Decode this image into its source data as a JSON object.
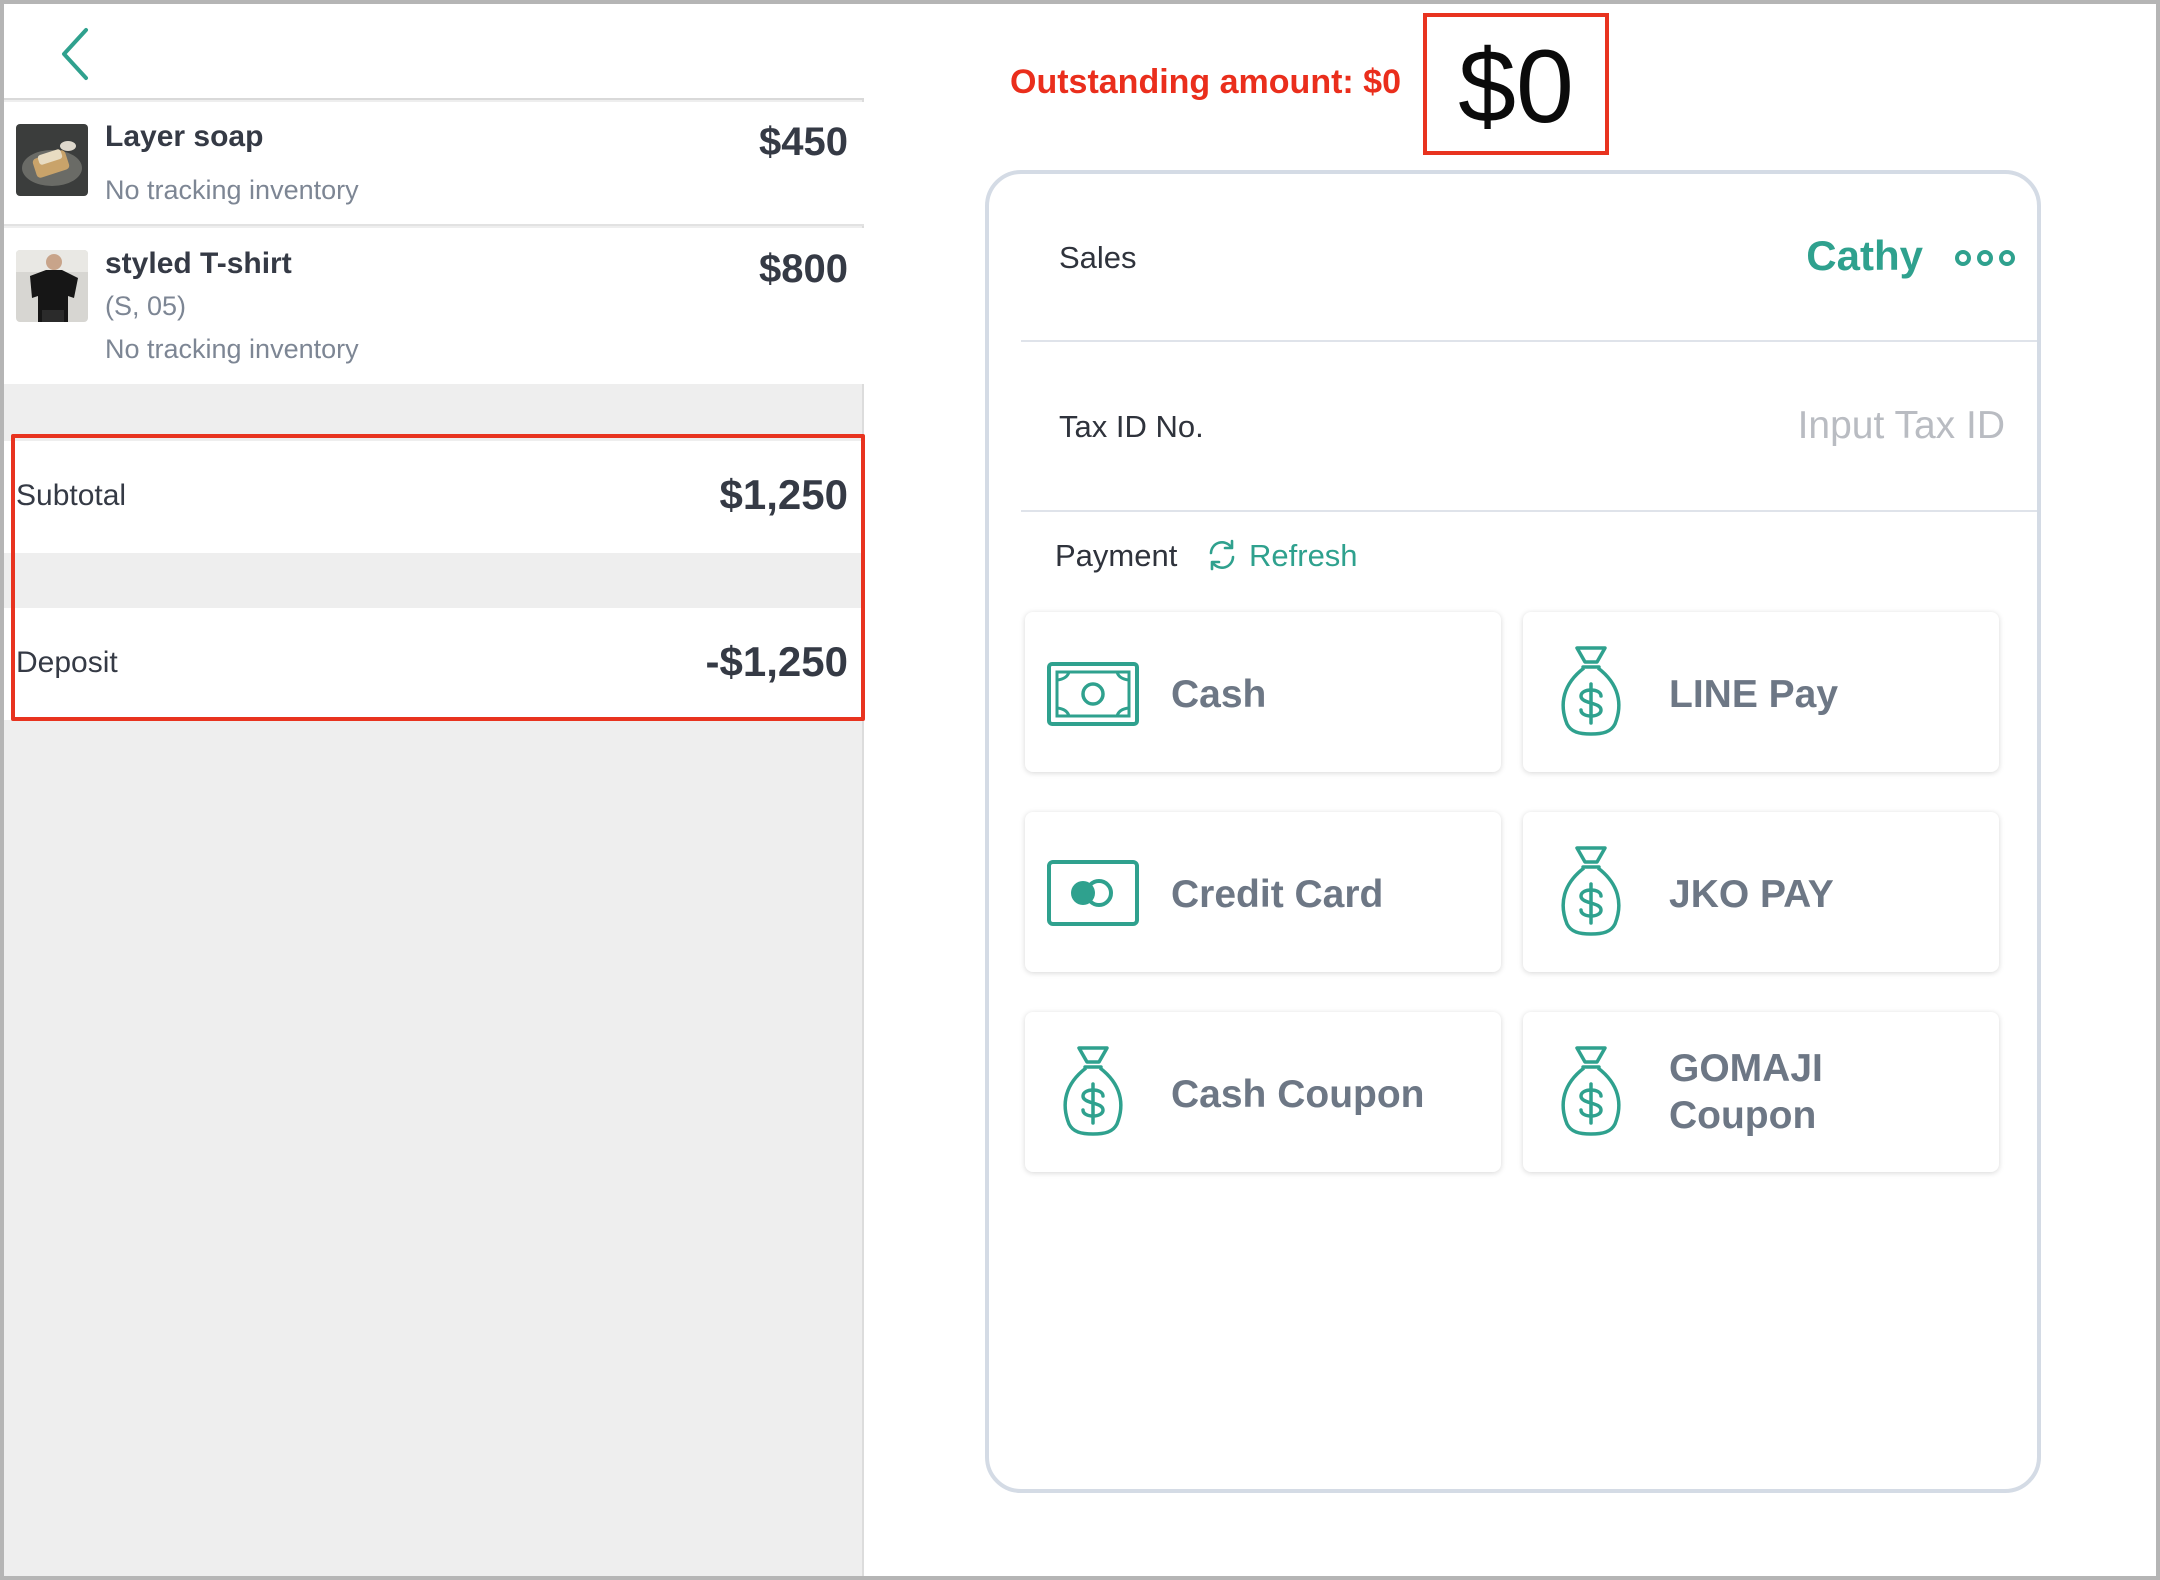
{
  "header": {
    "back_icon": "chevron-left-icon"
  },
  "items": [
    {
      "name": "Layer soap",
      "price": "$450",
      "variant": "",
      "tracking": "No tracking inventory"
    },
    {
      "name": "styled T-shirt",
      "price": "$800",
      "variant": "(S, 05)",
      "tracking": "No tracking inventory"
    }
  ],
  "summary": {
    "subtotal_label": "Subtotal",
    "subtotal_value": "$1,250",
    "deposit_label": "Deposit",
    "deposit_value": "-$1,250"
  },
  "outstanding": {
    "label": "Outstanding amount: $0",
    "amount": "$0"
  },
  "form": {
    "sales_label": "Sales",
    "sales_name": "Cathy",
    "tax_label": "Tax ID No.",
    "tax_value": "",
    "tax_placeholder": "Input Tax ID",
    "payment_label": "Payment",
    "refresh_label": "Refresh"
  },
  "payments": [
    {
      "label": "Cash",
      "icon": "banknote-icon"
    },
    {
      "label": "LINE Pay",
      "icon": "money-bag-icon"
    },
    {
      "label": "Credit Card",
      "icon": "credit-card-icon"
    },
    {
      "label": "JKO PAY",
      "icon": "money-bag-icon"
    },
    {
      "label": "Cash Coupon",
      "icon": "money-bag-icon"
    },
    {
      "label": "GOMAJI Coupon",
      "icon": "money-bag-icon"
    }
  ],
  "colors": {
    "accent": "#2fa18e",
    "highlight": "#e8331f",
    "outstanding_text": "#ea2e1c",
    "panel_bg": "#eeeeee"
  }
}
